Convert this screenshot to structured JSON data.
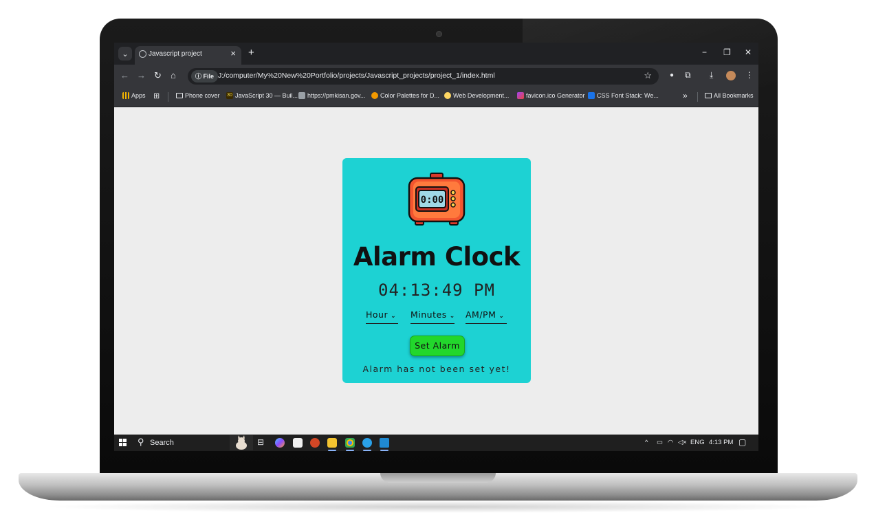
{
  "browser": {
    "tab_title": "Javascript project",
    "tab_close": "×",
    "new_tab": "+",
    "tab_list": "⌄",
    "window_controls": {
      "minimize": "−",
      "restore": "❐",
      "close": "✕"
    },
    "nav": {
      "back": "←",
      "forward": "→",
      "reload": "↻",
      "home": "⌂"
    },
    "address_chip": "ⓘ File",
    "url": "J:/computer/My%20New%20Portfolio/projects/Javascript_projects/project_1/index.html",
    "bookmark_star": "☆"
  },
  "bookmarks": {
    "items": [
      {
        "label": "Apps",
        "icon": "apps-grid-icon",
        "color": "#f4b400"
      },
      {
        "label": "Phone cover",
        "icon": "folder-icon"
      },
      {
        "label": "JavaScript 30 — Buil...",
        "icon": "js30-icon",
        "color": "#f0db4f"
      },
      {
        "label": "https://pmkisan.gov...",
        "icon": "pmkisan-icon",
        "color": "#9aa0a6"
      },
      {
        "label": "Color Palettes for D...",
        "icon": "color-palette-icon",
        "color": "#f29900"
      },
      {
        "label": "Web Development...",
        "icon": "web-dev-icon",
        "color": "#fdd663"
      },
      {
        "label": "favicon.ico Generator",
        "icon": "favicon-icon",
        "color": "#a142f4"
      },
      {
        "label": "CSS Font Stack: We...",
        "icon": "css-font-icon",
        "color": "#1a73e8"
      }
    ],
    "overflow": "»",
    "all_bookmarks": "All Bookmarks"
  },
  "app": {
    "title": "Alarm Clock",
    "clock_display": "0:00",
    "current_time": "04:13:49 PM",
    "hour_select": "Hour",
    "minutes_select": "Minutes",
    "ampm_select": "AM/PM",
    "set_button": "Set Alarm",
    "status": "Alarm has not been set yet!",
    "card_color": "#1dd2d3",
    "button_color": "#22d72c"
  },
  "taskbar": {
    "search_label": "Search",
    "tray_language": "ENG",
    "tray_time": "4:13 PM",
    "tray_chevron": "^"
  }
}
